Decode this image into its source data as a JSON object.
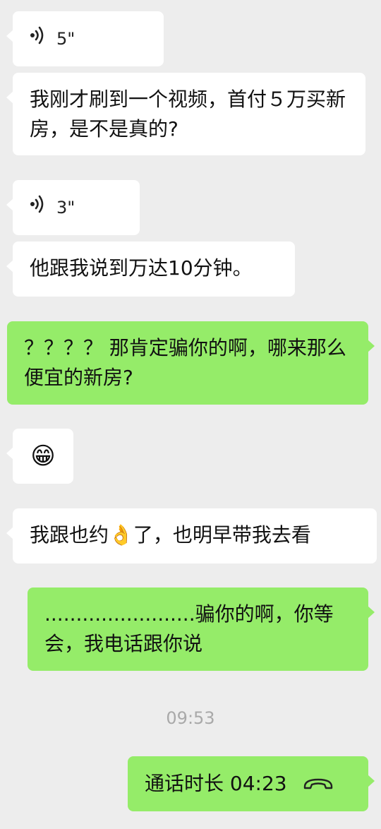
{
  "messages": [
    {
      "side": "in",
      "type": "voice",
      "duration": "5\""
    },
    {
      "side": "in",
      "type": "text",
      "text": "我刚才刷到一个视频，首付５万买新房，是不是真的?"
    },
    {
      "side": "in",
      "type": "voice",
      "duration": "3\""
    },
    {
      "side": "in",
      "type": "text",
      "text": "他跟我说到万达10分钟。"
    },
    {
      "side": "out",
      "type": "text",
      "text": "？？？？ 那肯定骗你的啊，哪来那么便宜的新房?"
    },
    {
      "side": "in",
      "type": "emoji",
      "emoji": "😁"
    },
    {
      "side": "in",
      "type": "text",
      "text_before": "我跟也约",
      "emoji": "👌",
      "text_after": "了，也明早带我去看"
    },
    {
      "side": "out",
      "type": "text",
      "text": "........................骗你的啊，你等会，我电话跟你说"
    },
    {
      "side": "out",
      "type": "call",
      "label": "通话时长 04:23"
    }
  ],
  "timestamp": "09:53",
  "icons": {
    "voice": "voice-wave-icon",
    "call": "phone-hangup-icon"
  },
  "colors": {
    "background": "#ededed",
    "incoming": "#ffffff",
    "outgoing": "#95ec69",
    "timestamp": "#a9a9a9"
  }
}
